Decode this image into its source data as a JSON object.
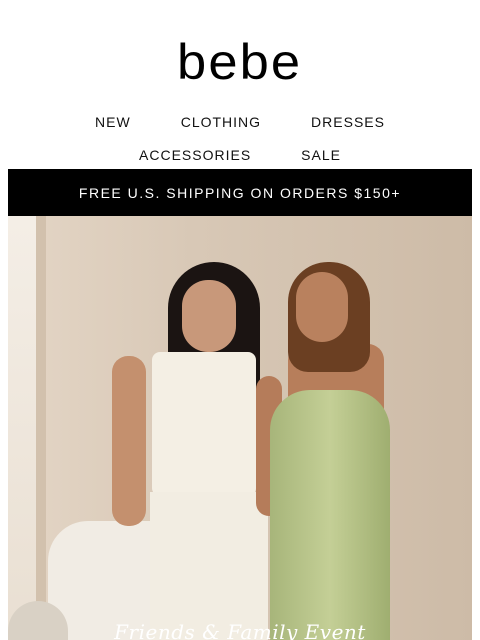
{
  "brand": {
    "logo_text": "bebe"
  },
  "nav": {
    "row1": [
      "NEW",
      "CLOTHING",
      "DRESSES"
    ],
    "row2": [
      "ACCESSORIES",
      "SALE"
    ]
  },
  "promo": {
    "text": "FREE U.S. SHIPPING ON ORDERS $150+"
  },
  "hero": {
    "headline": "Friends & Family Event",
    "image_description": "two models, one in white corset top and pants, one in sage green satin dress"
  }
}
